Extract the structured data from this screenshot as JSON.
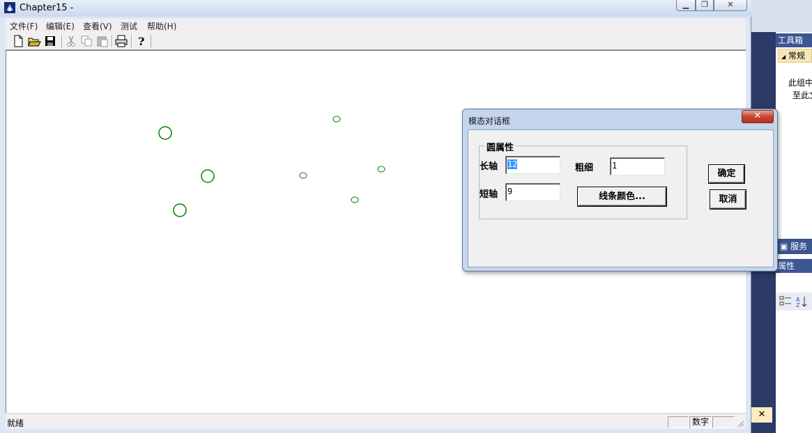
{
  "window": {
    "title": "Chapter15 -"
  },
  "menu": {
    "items": [
      "文件(F)",
      "编辑(E)",
      "查看(V)",
      "测试",
      "帮助(H)"
    ]
  },
  "toolbar": {
    "buttons": [
      "new-icon",
      "open-icon",
      "save-icon",
      "cut-icon",
      "copy-icon",
      "paste-icon",
      "print-icon",
      "help-icon"
    ]
  },
  "canvas": {
    "shape_color": "#008000"
  },
  "status": {
    "text": "就绪",
    "num_indicator": "数字"
  },
  "dialog": {
    "title": "模态对话框",
    "close_label": "✕",
    "group_title": "圆属性",
    "major_axis_label": "长轴",
    "major_axis_value": "12",
    "minor_axis_label": "短轴",
    "minor_axis_value": "9",
    "thickness_label": "粗细",
    "thickness_value": "1",
    "line_color_button": "线条颜色...",
    "ok_button": "确定",
    "cancel_button": "取消"
  },
  "ide": {
    "toolbox_title": "工具箱",
    "group_label": "常规",
    "hint_line1": "此组中",
    "hint_line2": "至此文",
    "server_label": "服务",
    "properties_label": "属性",
    "close_label": "✕"
  }
}
